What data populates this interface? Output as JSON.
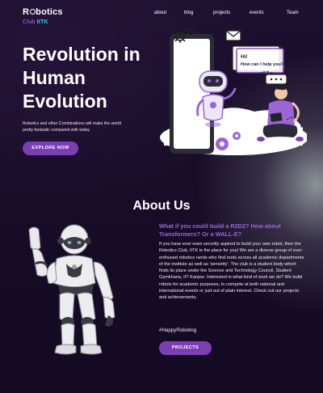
{
  "nav": {
    "logo_main_pre": "R",
    "logo_main_post": "botics",
    "logo_sub_club": "Club",
    "logo_sub_iitk": "IITK",
    "links": [
      "about",
      "blog",
      "projects",
      "events",
      "Team"
    ]
  },
  "hero": {
    "title": "Revolution in Human Evolution",
    "subtitle": "Robotics and other Combinations will make the world pretty fantastic compared with today",
    "cta": "EXPLORE NOW",
    "bubble_text": "Hi! How can I help you?"
  },
  "about": {
    "title": "About Us",
    "question": "What if you could build a R2D2? How about Transformers? Or a WALL-E?",
    "body": "If you have ever even secretly aspired to build your own robot, then the Robotics Club, IITK is the place for you! We are a diverse group of ever-enthused robotics nerds who find roots across all academic departments of the institute as well as 'seniority'. The club is a student body which finds its place under the Science and Technology Council, Student Gymkhana, IIT Kanpur. Interested in what kind of work we do? We build robots for academic purposes, to compete at both national and international events or just out of plain interest. Check out our projects and achievements.",
    "hashtag": "#HappyRoboting",
    "cta": "PROJECTS"
  },
  "colors": {
    "accent": "#7c3fb3",
    "highlight": "#9b65d6",
    "background": "#1a0f2c"
  },
  "icons": [
    "gear-icon",
    "envelope-icon",
    "chat-bubble-icon",
    "robot-illustration",
    "humanoid-robot-image"
  ]
}
